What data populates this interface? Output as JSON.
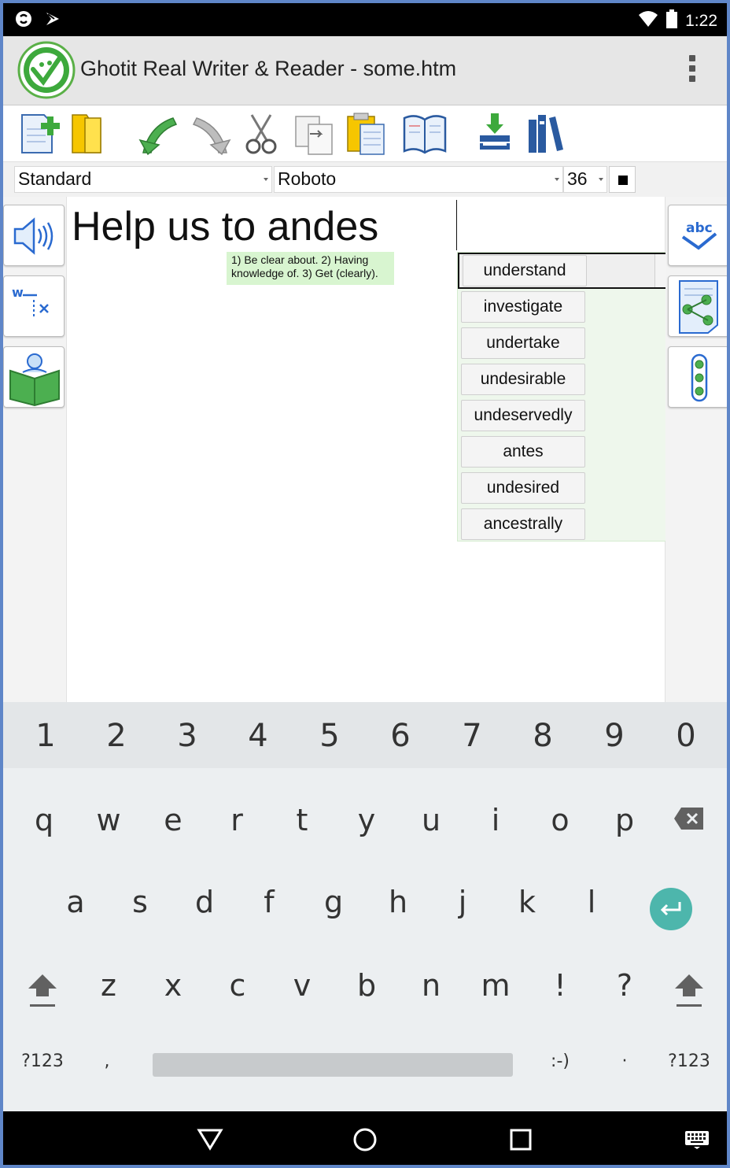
{
  "status_bar": {
    "time": "1:22",
    "icons": [
      "sync-icon",
      "notification-icon",
      "wifi-icon",
      "battery-icon"
    ]
  },
  "app_bar": {
    "title": "Ghotit Real Writer & Reader - some.htm",
    "logo": "ghotit-logo-icon",
    "overflow": "overflow-menu-icon"
  },
  "toolbar": {
    "buttons": [
      "new-document-icon",
      "open-folder-icon",
      "undo-icon",
      "redo-icon",
      "cut-icon",
      "copy-icon",
      "paste-icon",
      "dictionary-icon",
      "import-icon",
      "library-icon"
    ]
  },
  "format_bar": {
    "style": "Standard",
    "font": "Roboto",
    "size": "36",
    "color": "#000000"
  },
  "left_panel": {
    "buttons": [
      "speaker-icon",
      "word-prediction-icon",
      "reader-icon"
    ]
  },
  "right_panel": {
    "buttons": [
      "spell-check-icon",
      "share-document-icon",
      "more-options-icon"
    ]
  },
  "document": {
    "text": "Help us to andes",
    "definition": "1) Be clear about. 2) Having knowledge of. 3) Get (clearly)."
  },
  "suggestions": {
    "more_label": "»",
    "items": [
      "understand",
      "investigate",
      "undertake",
      "undesirable",
      "undeservedly",
      "antes",
      "undesired",
      "ancestrally"
    ]
  },
  "keyboard": {
    "numbers": [
      "1",
      "2",
      "3",
      "4",
      "5",
      "6",
      "7",
      "8",
      "9",
      "0"
    ],
    "row_q": [
      "q",
      "w",
      "e",
      "r",
      "t",
      "y",
      "u",
      "i",
      "o",
      "p"
    ],
    "row_a": [
      "a",
      "s",
      "d",
      "f",
      "g",
      "h",
      "j",
      "k",
      "l"
    ],
    "row_z": [
      "z",
      "x",
      "c",
      "v",
      "b",
      "n",
      "m",
      "!",
      "?"
    ],
    "bottom": {
      "symbols_left": "?123",
      "comma": ",",
      "emoticon": ":-)",
      "period": "·",
      "symbols_right": "?123"
    },
    "accent_color": "#4db6ac"
  },
  "nav_bar": {
    "buttons": [
      "back-icon",
      "home-icon",
      "recents-icon",
      "keyboard-switch-icon"
    ]
  }
}
